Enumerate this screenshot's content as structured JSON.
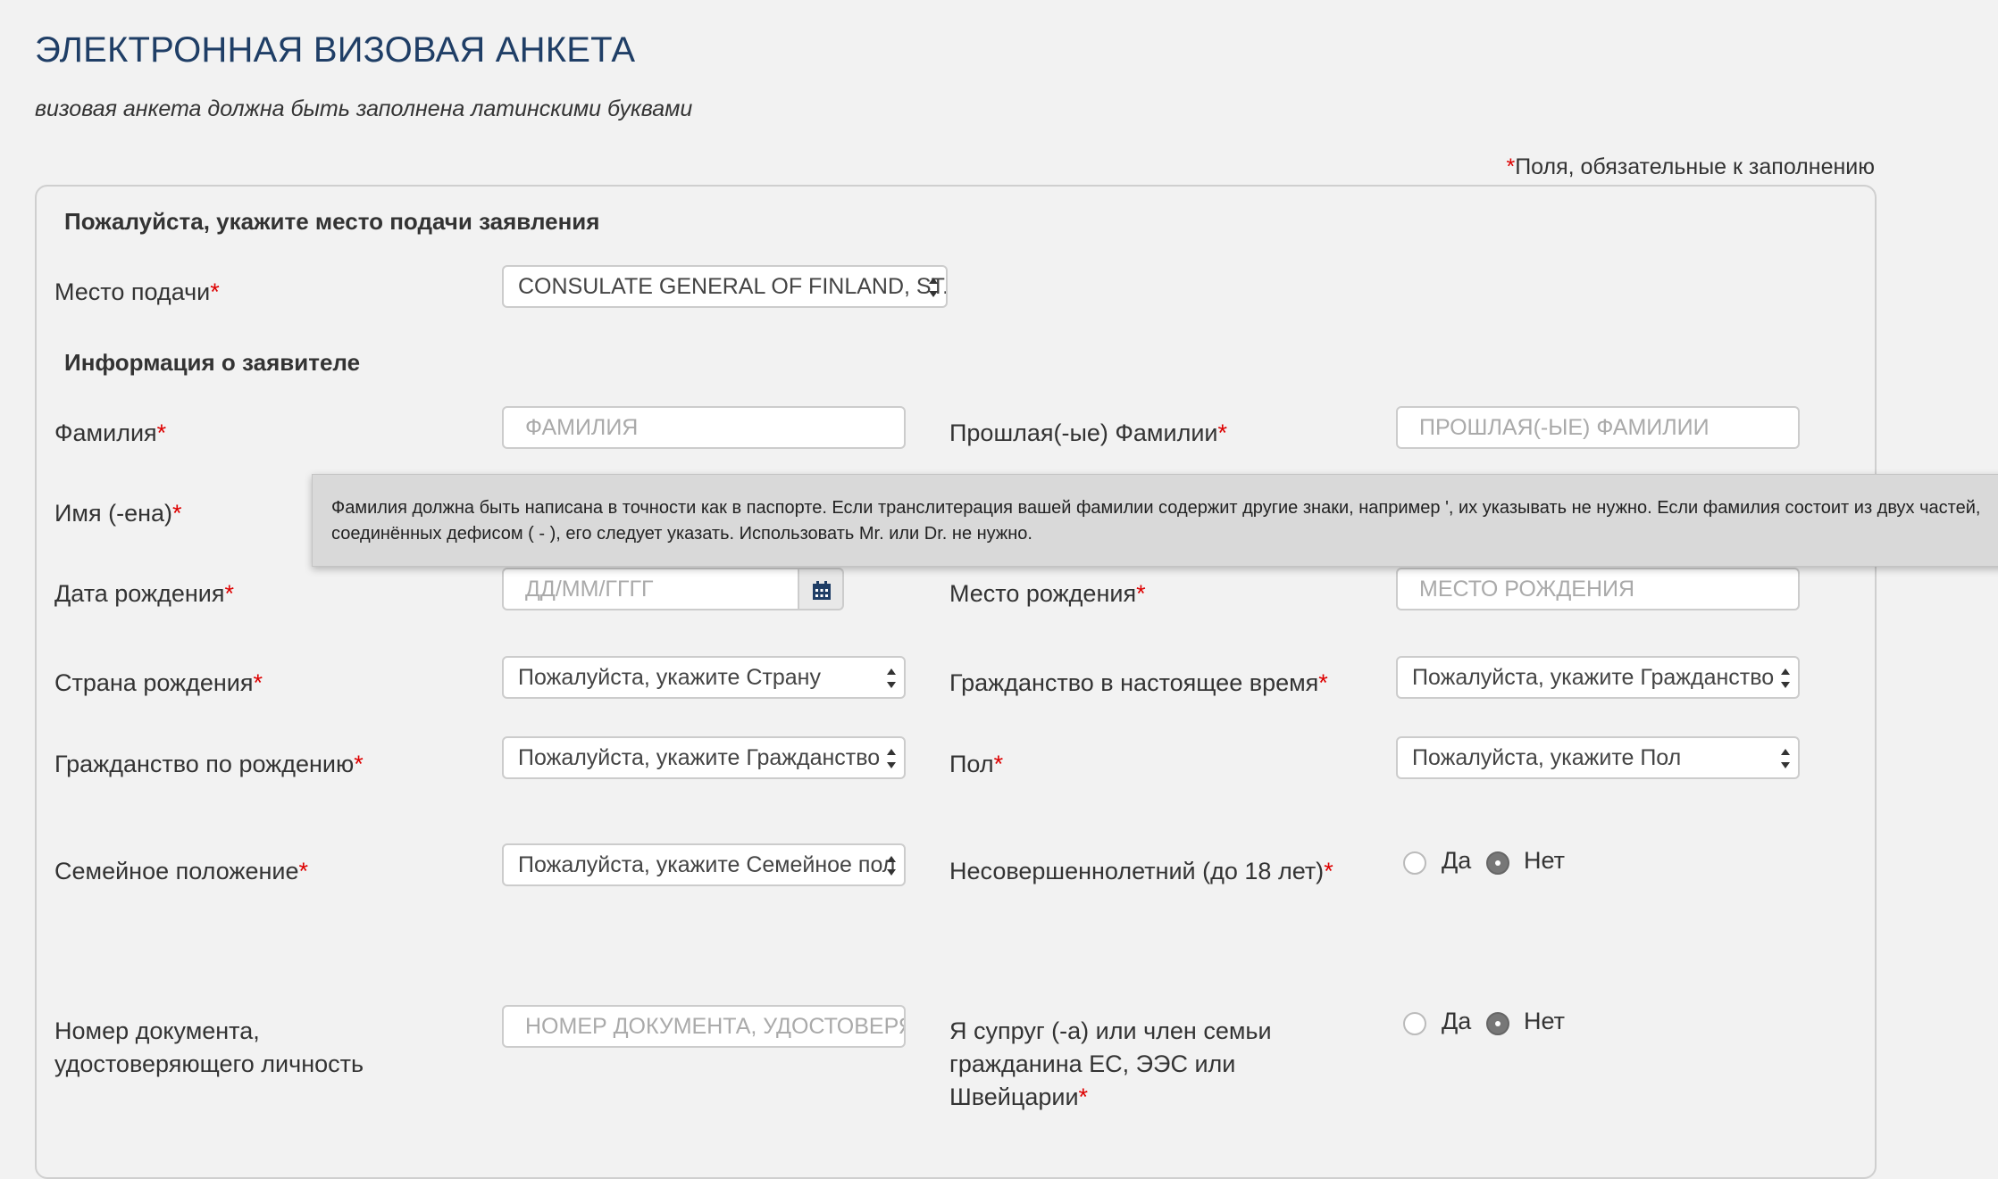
{
  "header": {
    "title": "ЭЛЕКТРОННАЯ ВИЗОВАЯ АНКЕТА",
    "subtitle": "визовая анкета должна быть заполнена латинскими буквами",
    "required_note": "Поля, обязательные к заполнению",
    "required_mark": "*"
  },
  "sections": {
    "location_title": "Пожалуйста, укажите место подачи заявления",
    "applicant_title": "Информация о заявителе"
  },
  "fields": {
    "submission_place": {
      "label": "Место подачи",
      "value": "CONSULATE GENERAL OF FINLAND, ST."
    },
    "surname": {
      "label": "Фамилия",
      "placeholder": "ФАМИЛИЯ"
    },
    "previous_surnames": {
      "label": "Прошлая(-ые) Фамилии",
      "placeholder": "ПРОШЛАЯ(-ЫЕ) ФАМИЛИИ"
    },
    "first_name": {
      "label": "Имя (-ена)"
    },
    "birth_date": {
      "label": "Дата рождения",
      "placeholder": "ДД/ММ/ГГГГ"
    },
    "birth_place": {
      "label": "Место рождения",
      "placeholder": "МЕСТО РОЖДЕНИЯ"
    },
    "birth_country": {
      "label": "Страна рождения",
      "value": "Пожалуйста, укажите Страну"
    },
    "current_citizenship": {
      "label": "Гражданство в настоящее время",
      "value": "Пожалуйста, укажите Гражданство"
    },
    "birth_citizenship": {
      "label": "Гражданство по рождению",
      "value": "Пожалуйста, укажите Гражданство"
    },
    "sex": {
      "label": "Пол",
      "value": "Пожалуйста, укажите Пол"
    },
    "marital_status": {
      "label": "Семейное положение",
      "value": "Пожалуйста, укажите Семейное пол"
    },
    "minor": {
      "label": "Несовершеннолетний (до 18 лет)",
      "yes": "Да",
      "no": "Нет",
      "selected": "no"
    },
    "id_number": {
      "label_line1": "Номер документа,",
      "label_line2": "удостоверяющего личность",
      "placeholder": "НОМЕР ДОКУМЕНТА, УДОСТОВЕРЯЮ"
    },
    "eu_family": {
      "label_line1": "Я супруг (-а) или член семьи",
      "label_line2": "гражданина ЕС, ЭЭС или",
      "label_line3": "Швейцарии",
      "yes": "Да",
      "no": "Нет",
      "selected": "no"
    }
  },
  "tooltip": {
    "line1": "Фамилия должна быть написана в точности как в паспорте. Если транслитерация вашей фамилии содержит другие знаки, например ', их указывать не нужно. Если фамилия состоит из двух частей,",
    "line2": "соединённых дефисом ( - ), его следует указать. Использовать Mr. или Dr. не нужно."
  },
  "icons": {
    "calendar": "calendar-icon"
  },
  "colors": {
    "title": "#1f3e66",
    "required": "#dd0000",
    "tooltip_bg": "#d9d9d9"
  }
}
